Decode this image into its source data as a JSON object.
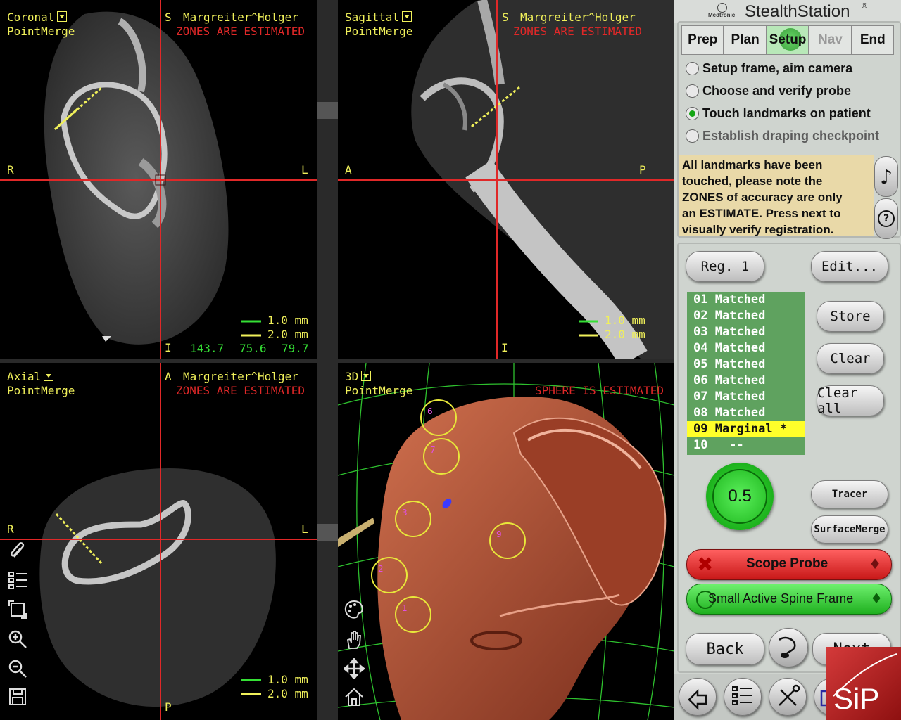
{
  "app": {
    "brand": "Medtronic",
    "title": "StealthStation",
    "trademark": "®"
  },
  "viewports": {
    "coronal": {
      "view": "Coronal",
      "mode": "PointMerge",
      "orient_top": "S",
      "orient_left": "R",
      "orient_right": "L",
      "orient_bottom": "I",
      "patient": "Margreiter^Holger",
      "warning": "ZONES ARE ESTIMATED",
      "scale1": "1.0 mm",
      "scale2": "2.0 mm",
      "coord_x": "143.7",
      "coord_y": "75.6",
      "coord_z": "79.7"
    },
    "sagittal": {
      "view": "Sagittal",
      "mode": "PointMerge",
      "orient_top": "S",
      "orient_left": "A",
      "orient_right": "P",
      "orient_bottom": "I",
      "patient": "Margreiter^Holger",
      "warning": "ZONES ARE ESTIMATED",
      "scale1": "1.0 mm",
      "scale2": "2.0 mm"
    },
    "axial": {
      "view": "Axial",
      "mode": "PointMerge",
      "orient_top": "A",
      "orient_left": "R",
      "orient_right": "L",
      "orient_bottom": "P",
      "patient": "Margreiter^Holger",
      "warning": "ZONES ARE ESTIMATED",
      "scale1": "1.0 mm",
      "scale2": "2.0 mm"
    },
    "three_d": {
      "view": "3D",
      "mode": "PointMerge",
      "warning": "SPHERE IS ESTIMATED",
      "landmarks": [
        "1",
        "2",
        "3",
        "6",
        "7",
        "9"
      ]
    }
  },
  "tools_left": [
    "paperclip-icon",
    "checklist-icon",
    "rotate-frame-icon",
    "zoom-in-icon",
    "zoom-out-icon",
    "save-disk-icon"
  ],
  "tools_3d": [
    "palette-icon",
    "hand-icon",
    "move-arrows-icon",
    "home-icon"
  ],
  "tabs": [
    {
      "label": "Prep",
      "enabled": true
    },
    {
      "label": "Plan",
      "enabled": true
    },
    {
      "label": "Setup",
      "enabled": true,
      "active": true
    },
    {
      "label": "Nav",
      "enabled": false
    },
    {
      "label": "End",
      "enabled": true
    }
  ],
  "steps": [
    {
      "label": "Setup frame, aim camera",
      "selected": false
    },
    {
      "label": "Choose and verify probe",
      "selected": false
    },
    {
      "label": "Touch landmarks on patient",
      "selected": true
    },
    {
      "label": "Establish draping checkpoint",
      "selected": false
    }
  ],
  "message": {
    "line1": "All landmarks have been",
    "line2": "touched, please note the",
    "line3": "ZONES of accuracy are only",
    "line4": "an ESTIMATE.  Press next to",
    "line5": "visually verify registration."
  },
  "buttons": {
    "reg": "Reg. 1",
    "edit": "Edit...",
    "store": "Store",
    "clear": "Clear",
    "clear_all": "Clear all",
    "accuracy": "0.5",
    "tracer": "Tracer",
    "surface_merge": "SurfaceMerge",
    "scope_probe": "Scope Probe",
    "spine_frame": "Small Active Spine Frame",
    "back": "Back",
    "next": "Next"
  },
  "landmarks": [
    {
      "num": "01",
      "status": "Matched"
    },
    {
      "num": "02",
      "status": "Matched"
    },
    {
      "num": "03",
      "status": "Matched"
    },
    {
      "num": "04",
      "status": "Matched"
    },
    {
      "num": "05",
      "status": "Matched"
    },
    {
      "num": "06",
      "status": "Matched"
    },
    {
      "num": "07",
      "status": "Matched"
    },
    {
      "num": "08",
      "status": "Matched"
    },
    {
      "num": "09",
      "status": "Marginal *",
      "selected": true
    },
    {
      "num": "10",
      "status": "--"
    }
  ],
  "dock_icons": [
    "undo-arrow-icon",
    "checklist-icon",
    "tools-icon",
    "camera-icon"
  ],
  "watermark": "SiP",
  "colors": {
    "crosshair": "#e02828",
    "overlay_text": "#f0f05a",
    "coord_text": "#35e035",
    "list_bg": "#5fa25f",
    "list_selected": "#ffff2a",
    "accuracy_green": "#19c219",
    "probe_red": "#e83030",
    "frame_green": "#2fd02f",
    "bone_model": "#b8563a"
  }
}
